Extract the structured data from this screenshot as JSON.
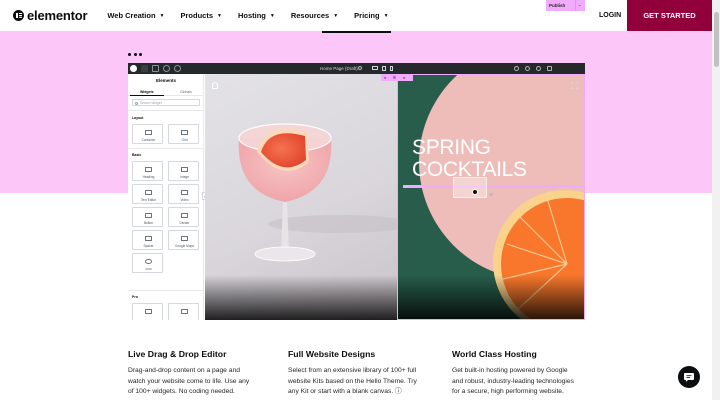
{
  "nav": {
    "brand": "elementor",
    "items": [
      "Web Creation",
      "Products",
      "Hosting",
      "Resources",
      "Pricing"
    ],
    "login": "LOGIN",
    "cta": "GET STARTED"
  },
  "editor": {
    "page_title": "Home Page (Draft)",
    "publish_label": "Publish",
    "panel_title": "Elements",
    "tabs": [
      "Widgets",
      "Globals"
    ],
    "search_placeholder": "Search Widget",
    "categories": [
      "Layout",
      "Basic",
      "Pro"
    ],
    "layout_widgets": [
      "Container",
      "Grid"
    ],
    "basic_widgets": [
      "Heading",
      "Image",
      "Text Editor",
      "Video",
      "Button",
      "Divider",
      "Spacer",
      "Google Maps",
      "Icon"
    ],
    "hero_heading_line1": "SPRING",
    "hero_heading_line2": "COCKTAILS"
  },
  "features": [
    {
      "title": "Live Drag & Drop Editor",
      "lines": [
        "Drag-and-drop content on a page and",
        "watch your website come to life. Use any",
        "of 100+ widgets. No coding needed."
      ]
    },
    {
      "title": "Full Website Designs",
      "lines": [
        "Select from an extensive library of 100+ full",
        "website Kits based on the Hello Theme. Try",
        "any Kit or start with a blank canvas. ⓘ"
      ]
    },
    {
      "title": "World Class Hosting",
      "lines": [
        "Get built-in hosting powered by Google",
        "and robust, industry-leading technologies",
        "for a secure, high performing website."
      ]
    }
  ],
  "colors": {
    "hero_bg": "#fcc6f8",
    "cta_bg": "#92003b",
    "accent_pink": "#f0abfc",
    "canvas_green": "#285d4b"
  },
  "icons": {
    "chat": "chat-bubble-icon",
    "logo": "elementor-logo-icon"
  }
}
